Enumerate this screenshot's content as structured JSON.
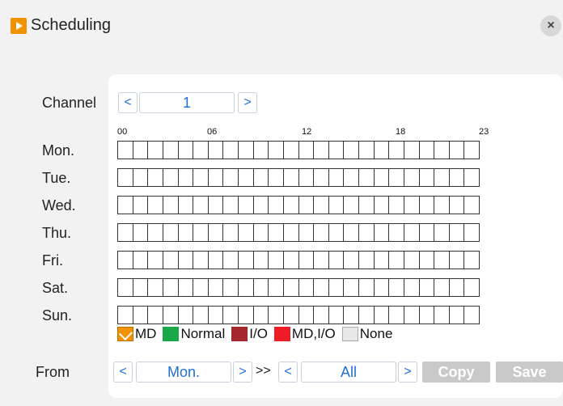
{
  "window": {
    "title": "Scheduling"
  },
  "channel": {
    "label": "Channel",
    "value": "1",
    "prev": "<",
    "next": ">"
  },
  "hours": [
    "00",
    "06",
    "12",
    "18",
    "23"
  ],
  "days": [
    "Mon.",
    "Tue.",
    "Wed.",
    "Thu.",
    "Fri.",
    "Sat.",
    "Sun."
  ],
  "slots_per_day": 24,
  "legend": [
    {
      "key": "md",
      "label": "MD",
      "color": "#f39200",
      "checked": true
    },
    {
      "key": "normal",
      "label": "Normal",
      "color": "#1aa74a"
    },
    {
      "key": "io",
      "label": "I/O",
      "color": "#a5262c"
    },
    {
      "key": "mdio",
      "label": "MD,I/O",
      "color": "#ee1c24"
    },
    {
      "key": "none",
      "label": "None",
      "color": "#e8e8e8"
    }
  ],
  "copy": {
    "from_label": "From",
    "from_value": "Mon.",
    "separator": ">>",
    "to_value": "All",
    "prev": "<",
    "next": ">",
    "copy_button": "Copy",
    "save_button": "Save"
  },
  "close_glyph": "×"
}
